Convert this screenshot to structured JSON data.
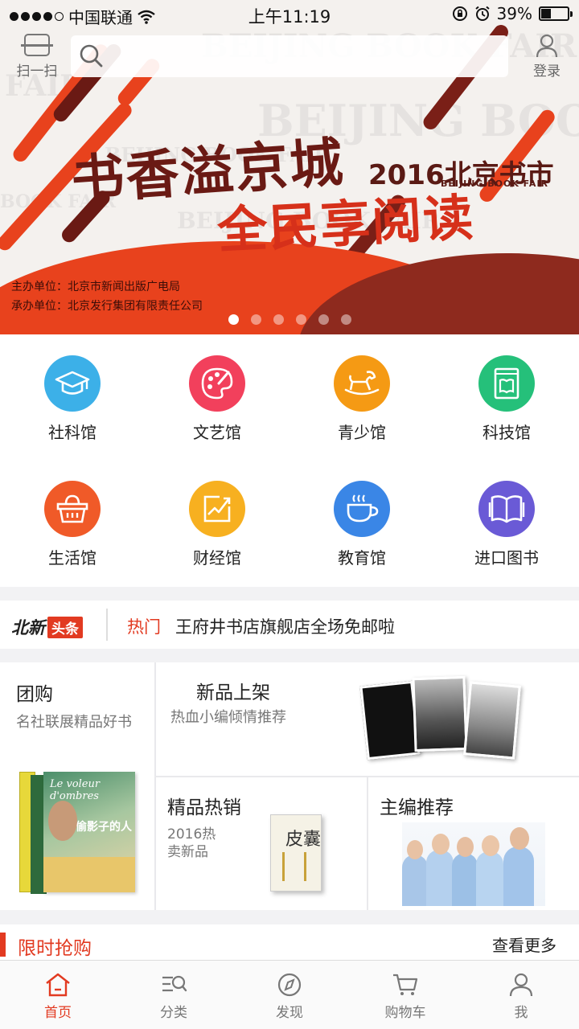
{
  "status_bar": {
    "carrier": "中国联通",
    "time": "上午11:19",
    "battery": "39%",
    "battery_level": 0.39
  },
  "header": {
    "scan_label": "扫一扫",
    "search_placeholder": "",
    "login_label": "登录"
  },
  "banner": {
    "headline_1": "书香溢京城",
    "headline_2": "全民享阅读",
    "fair_title": "2016北京书市",
    "fair_en": "BEIJING BOOK FAIR",
    "watermarks": [
      "BEIJING BOOK FAIR",
      "BEIJING BOOK",
      "BOOK FAIR",
      "BEIJING BOOK FAIR",
      "BEIJING BOOK FAIR",
      "FAIR"
    ],
    "organizer": "主办单位：北京市新闻出版广电局",
    "co_organizer": "承办单位：北京发行集团有限责任公司",
    "page_count": 6,
    "active_page": 0
  },
  "categories": [
    {
      "label": "社科馆",
      "color": "#3cb0e8",
      "icon": "graduation-cap-icon"
    },
    {
      "label": "文艺馆",
      "color": "#f2405c",
      "icon": "palette-icon"
    },
    {
      "label": "青少馆",
      "color": "#f59a14",
      "icon": "rocking-horse-icon"
    },
    {
      "label": "科技馆",
      "color": "#25c07a",
      "icon": "book-icon"
    },
    {
      "label": "生活馆",
      "color": "#f05a28",
      "icon": "shopping-basket-icon"
    },
    {
      "label": "财经馆",
      "color": "#f7b020",
      "icon": "trend-chart-icon"
    },
    {
      "label": "教育馆",
      "color": "#3a86e6",
      "icon": "coffee-cup-icon"
    },
    {
      "label": "进口图书",
      "color": "#6a5ad6",
      "icon": "open-book-icon"
    }
  ],
  "ticker": {
    "logo_a": "北新",
    "logo_b": "头条",
    "tag": "热门",
    "text": "王府井书店旗舰店全场免邮啦"
  },
  "promo": {
    "group_buy": {
      "title": "团购",
      "subtitle": "名社联展精品好书",
      "book_title": "Le voleur d'ombres",
      "book_cn": "偷影子的人"
    },
    "new_arrivals": {
      "title": "新品上架",
      "subtitle": "热血小编倾情推荐"
    },
    "best_sellers": {
      "title": "精品热销",
      "subtitle": "2016热卖新品",
      "book_title": "皮囊"
    },
    "editor_picks": {
      "title": "主编推荐"
    }
  },
  "flash_sale": {
    "title": "限时抢购",
    "more": "查看更多"
  },
  "tabs": [
    {
      "label": "首页",
      "icon": "home-icon",
      "active": true
    },
    {
      "label": "分类",
      "icon": "category-search-icon",
      "active": false
    },
    {
      "label": "发现",
      "icon": "compass-icon",
      "active": false
    },
    {
      "label": "购物车",
      "icon": "cart-icon",
      "active": false
    },
    {
      "label": "我",
      "icon": "user-icon",
      "active": false
    }
  ],
  "colors": {
    "accent": "#e23a21",
    "banner_red": "#e8421d",
    "banner_dark": "#8e2a1e"
  }
}
